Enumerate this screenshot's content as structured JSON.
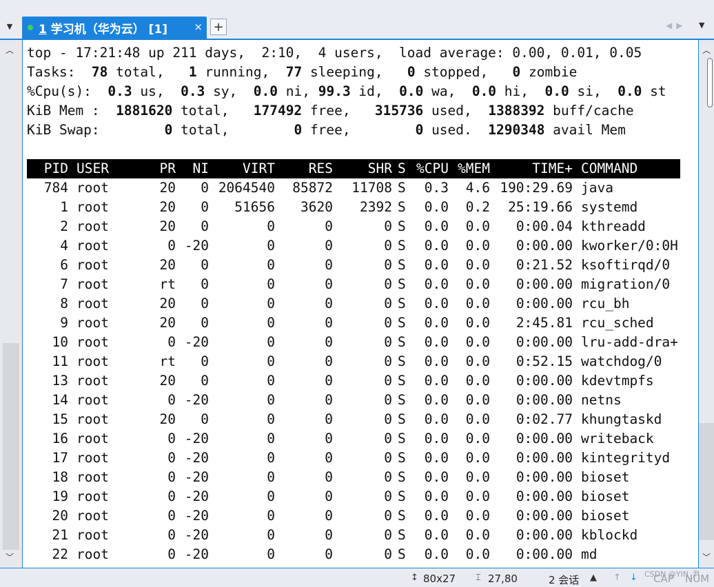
{
  "tabbar": {
    "tab_number": "1",
    "tab_title": "学习机（华为云） [1]",
    "close_glyph": "×",
    "add_glyph": "+",
    "status_color": "#3fd25a",
    "accent_color": "#1c83dd"
  },
  "summary": {
    "line1": "top - 17:21:48 up 211 days,  2:10,  4 users,  load average: 0.00, 0.01, 0.05",
    "tasks": {
      "label": "Tasks: ",
      "total": " 78",
      "t_total": " total,   ",
      "running": "1",
      "t_running": " running,  ",
      "sleeping": "77",
      "t_sleeping": " sleeping,   ",
      "stopped": "0",
      "t_stopped": " stopped,   ",
      "zombie": "0",
      "t_zombie": " zombie"
    },
    "cpu": {
      "label": "%Cpu(s):  ",
      "us": "0.3",
      "t_us": " us,  ",
      "sy": "0.3",
      "t_sy": " sy,  ",
      "ni": "0.0",
      "t_ni": " ni, ",
      "id": "99.3",
      "t_id": " id,  ",
      "wa": "0.0",
      "t_wa": " wa,  ",
      "hi": "0.0",
      "t_hi": " hi,  ",
      "si": "0.0",
      "t_si": " si,  ",
      "st": "0.0",
      "t_st": " st"
    },
    "mem": {
      "label": "KiB Mem :  ",
      "total": "1881620",
      "t_total": " total,   ",
      "free": "177492",
      "t_free": " free,   ",
      "used": "315736",
      "t_used": " used,  ",
      "cache": "1388392",
      "t_cache": " buff/cache"
    },
    "swap": {
      "label": "KiB Swap:        ",
      "total": "0",
      "t_total": " total,        ",
      "free": "0",
      "t_free": " free,        ",
      "used": "0",
      "t_used": " used.  ",
      "avail": "1290348",
      "t_avail": " avail Mem"
    }
  },
  "table": {
    "headers": {
      "pid": "PID",
      "user": "USER",
      "pr": "PR",
      "ni": "NI",
      "virt": "VIRT",
      "res": "RES",
      "shr": "SHR",
      "s": "S",
      "cpu": "%CPU",
      "mem": "%MEM",
      "time": "TIME+",
      "cmd": "COMMAND"
    },
    "rows": [
      [
        "784",
        "root",
        "20",
        "0",
        "2064540",
        "85872",
        "11708",
        "S",
        "0.3",
        "4.6",
        "190:29.69",
        "java"
      ],
      [
        "1",
        "root",
        "20",
        "0",
        "51656",
        "3620",
        "2392",
        "S",
        "0.0",
        "0.2",
        "25:19.66",
        "systemd"
      ],
      [
        "2",
        "root",
        "20",
        "0",
        "0",
        "0",
        "0",
        "S",
        "0.0",
        "0.0",
        "0:00.04",
        "kthreadd"
      ],
      [
        "4",
        "root",
        "0",
        "-20",
        "0",
        "0",
        "0",
        "S",
        "0.0",
        "0.0",
        "0:00.00",
        "kworker/0:0H"
      ],
      [
        "6",
        "root",
        "20",
        "0",
        "0",
        "0",
        "0",
        "S",
        "0.0",
        "0.0",
        "0:21.52",
        "ksoftirqd/0"
      ],
      [
        "7",
        "root",
        "rt",
        "0",
        "0",
        "0",
        "0",
        "S",
        "0.0",
        "0.0",
        "0:00.00",
        "migration/0"
      ],
      [
        "8",
        "root",
        "20",
        "0",
        "0",
        "0",
        "0",
        "S",
        "0.0",
        "0.0",
        "0:00.00",
        "rcu_bh"
      ],
      [
        "9",
        "root",
        "20",
        "0",
        "0",
        "0",
        "0",
        "S",
        "0.0",
        "0.0",
        "2:45.81",
        "rcu_sched"
      ],
      [
        "10",
        "root",
        "0",
        "-20",
        "0",
        "0",
        "0",
        "S",
        "0.0",
        "0.0",
        "0:00.00",
        "lru-add-dra+"
      ],
      [
        "11",
        "root",
        "rt",
        "0",
        "0",
        "0",
        "0",
        "S",
        "0.0",
        "0.0",
        "0:52.15",
        "watchdog/0"
      ],
      [
        "13",
        "root",
        "20",
        "0",
        "0",
        "0",
        "0",
        "S",
        "0.0",
        "0.0",
        "0:00.00",
        "kdevtmpfs"
      ],
      [
        "14",
        "root",
        "0",
        "-20",
        "0",
        "0",
        "0",
        "S",
        "0.0",
        "0.0",
        "0:00.00",
        "netns"
      ],
      [
        "15",
        "root",
        "20",
        "0",
        "0",
        "0",
        "0",
        "S",
        "0.0",
        "0.0",
        "0:02.77",
        "khungtaskd"
      ],
      [
        "16",
        "root",
        "0",
        "-20",
        "0",
        "0",
        "0",
        "S",
        "0.0",
        "0.0",
        "0:00.00",
        "writeback"
      ],
      [
        "17",
        "root",
        "0",
        "-20",
        "0",
        "0",
        "0",
        "S",
        "0.0",
        "0.0",
        "0:00.00",
        "kintegrityd"
      ],
      [
        "18",
        "root",
        "0",
        "-20",
        "0",
        "0",
        "0",
        "S",
        "0.0",
        "0.0",
        "0:00.00",
        "bioset"
      ],
      [
        "19",
        "root",
        "0",
        "-20",
        "0",
        "0",
        "0",
        "S",
        "0.0",
        "0.0",
        "0:00.00",
        "bioset"
      ],
      [
        "20",
        "root",
        "0",
        "-20",
        "0",
        "0",
        "0",
        "S",
        "0.0",
        "0.0",
        "0:00.00",
        "bioset"
      ],
      [
        "21",
        "root",
        "0",
        "-20",
        "0",
        "0",
        "0",
        "S",
        "0.0",
        "0.0",
        "0:00.00",
        "kblockd"
      ],
      [
        "22",
        "root",
        "0",
        "-20",
        "0",
        "0",
        "0",
        "S",
        "0.0",
        "0.0",
        "0:00.00",
        "md"
      ]
    ]
  },
  "statusbar": {
    "term_size": "80x27",
    "cursor_pos": "27,80",
    "sessions": "2 会话",
    "caps": "CAP",
    "num": "NUM",
    "watermark": "CSDN @YIN_尹"
  },
  "icons": {
    "tab_menu": "caret-down-icon",
    "scroll_up": "chevron-up-icon",
    "scroll_down": "chevron-down-icon",
    "resize": "resize-icon",
    "cursor": "cursor-icon",
    "arrow_up": "arrow-up-icon",
    "arrow_down": "arrow-down-icon"
  }
}
